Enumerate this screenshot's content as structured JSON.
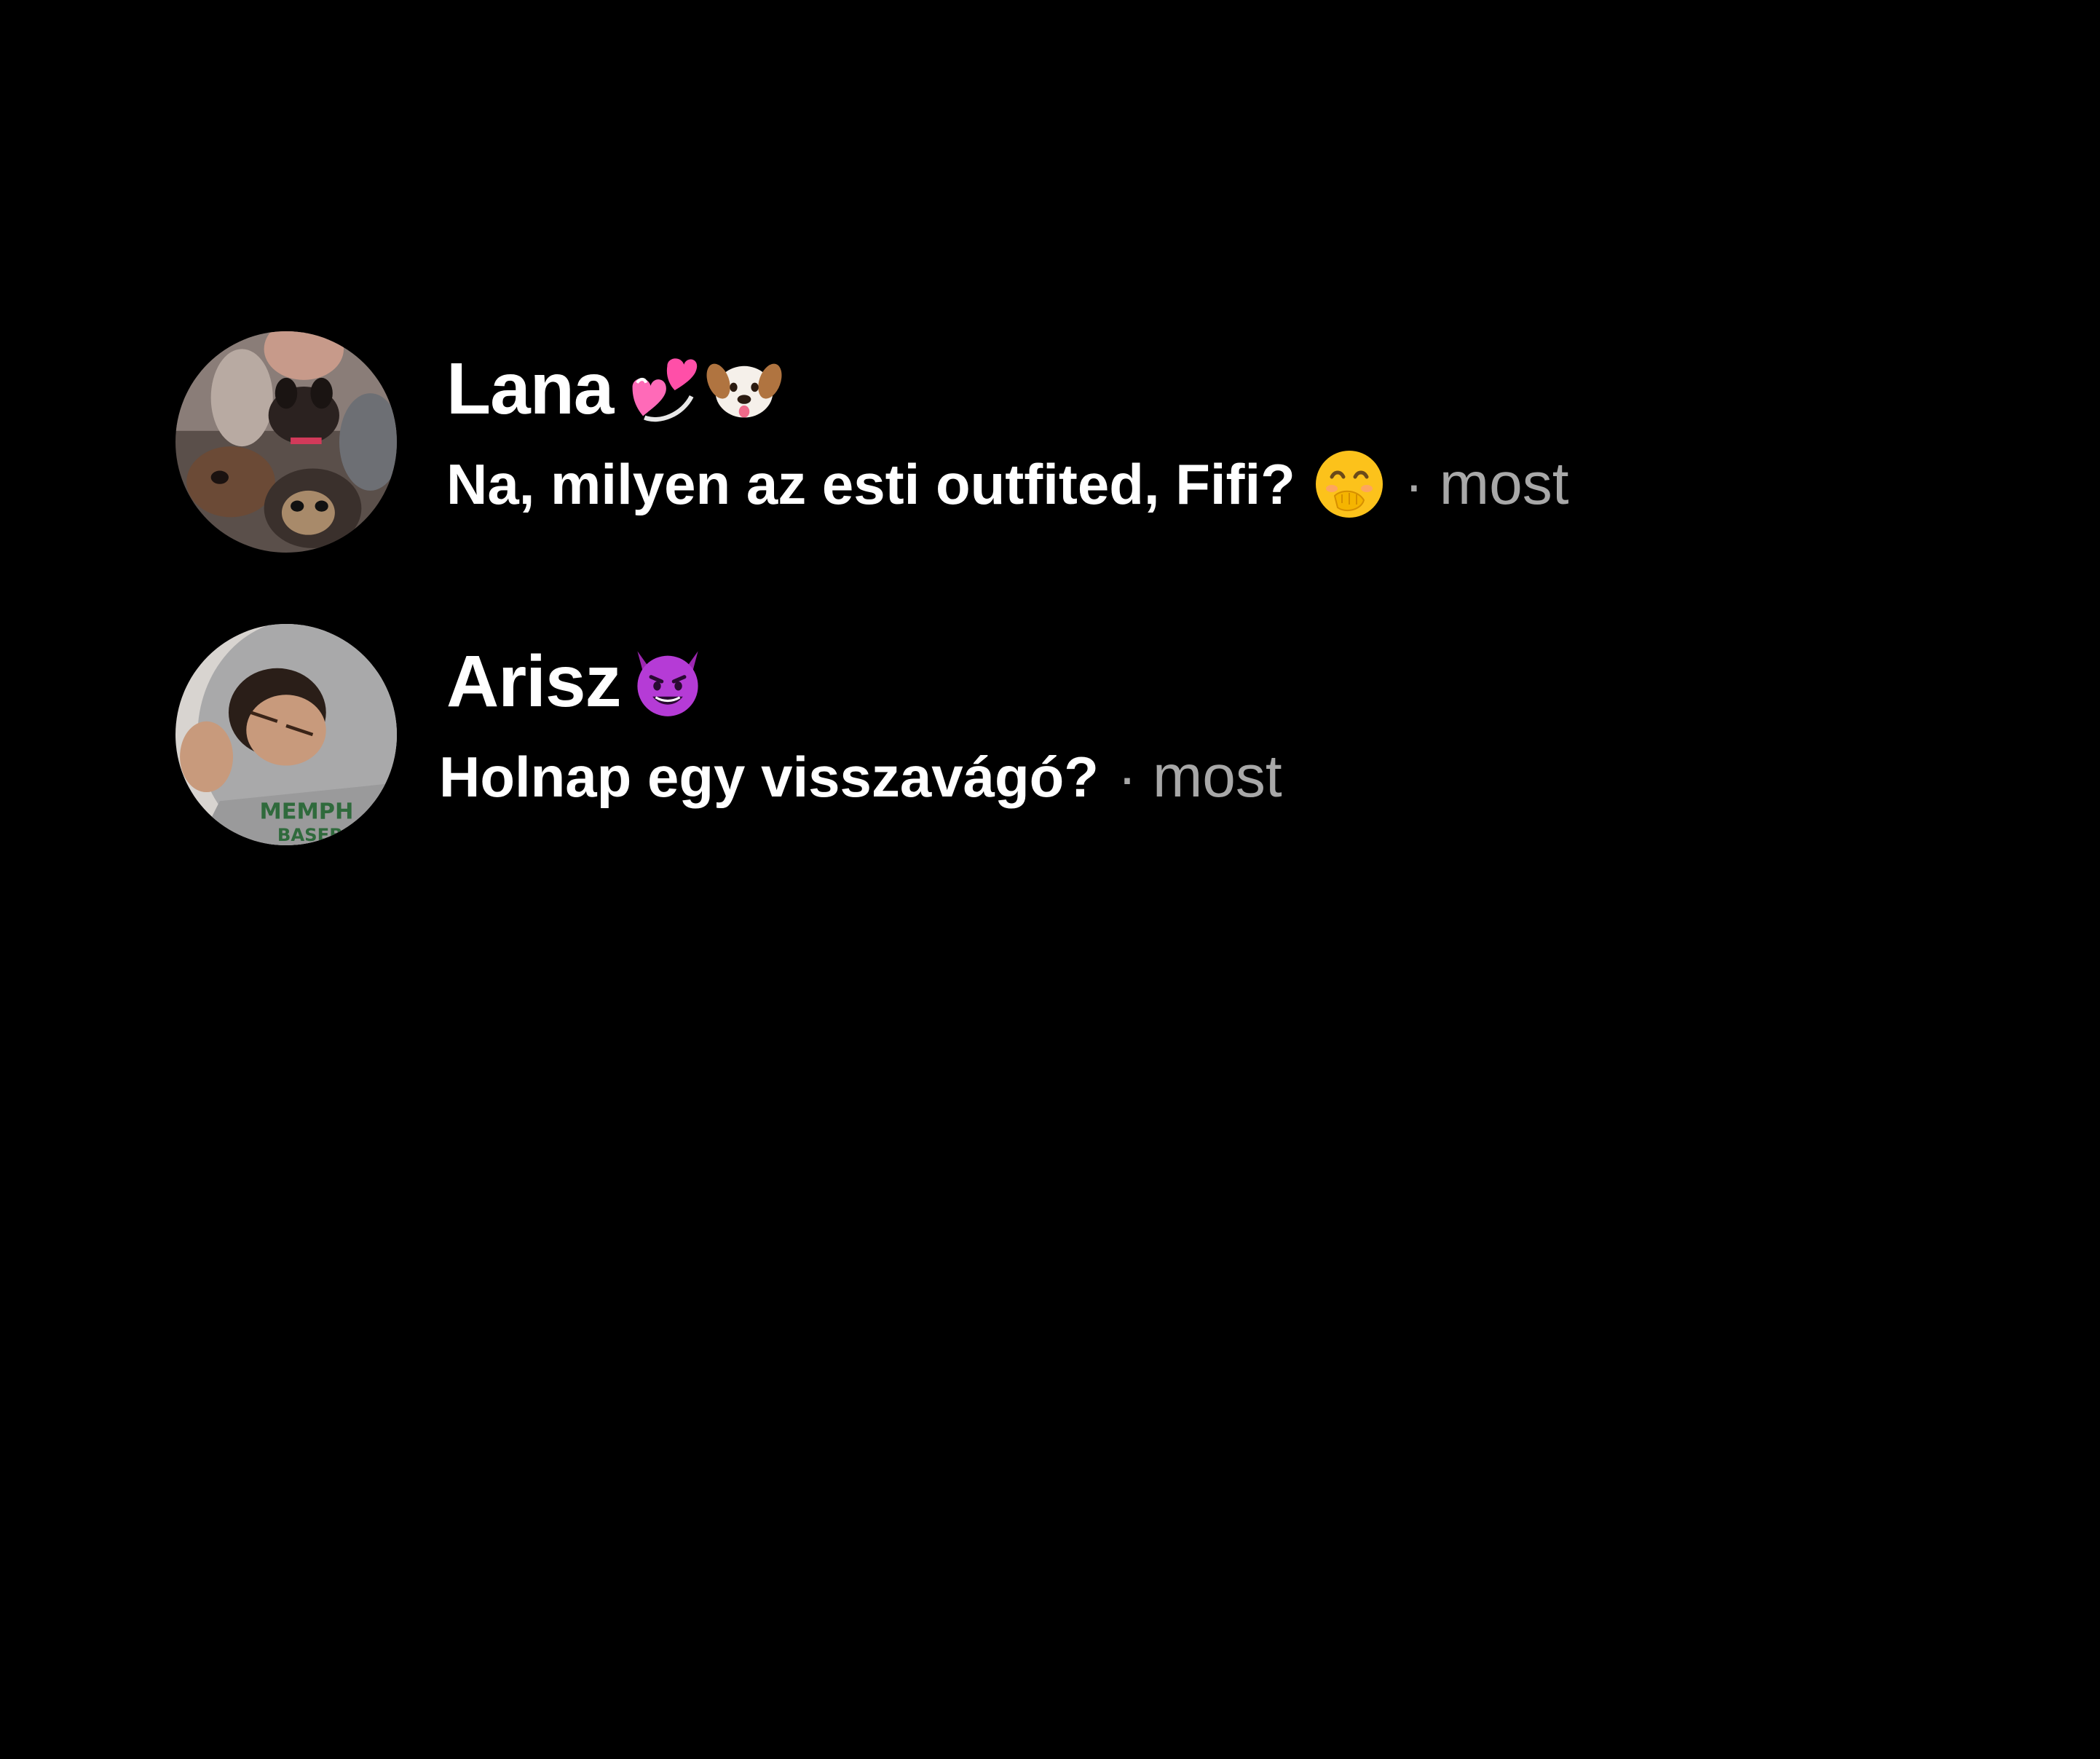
{
  "threads": [
    {
      "name": "Lana",
      "name_emojis": [
        "💞",
        "🐶"
      ],
      "message": "Na, milyen az esti outfited, Fifi?",
      "message_emoji": "🤭",
      "separator": "·",
      "time": "most",
      "avatar_description": "woman holding puppies"
    },
    {
      "name": "Arisz",
      "name_emojis": [
        "😈"
      ],
      "message": "Holnap egy visszavágó?",
      "separator": "·",
      "time": "most",
      "avatar_description": "young man in grey hoodie"
    }
  ],
  "colors": {
    "background": "#000000",
    "primary_text": "#ffffff",
    "secondary_text": "#a8a8a8"
  }
}
